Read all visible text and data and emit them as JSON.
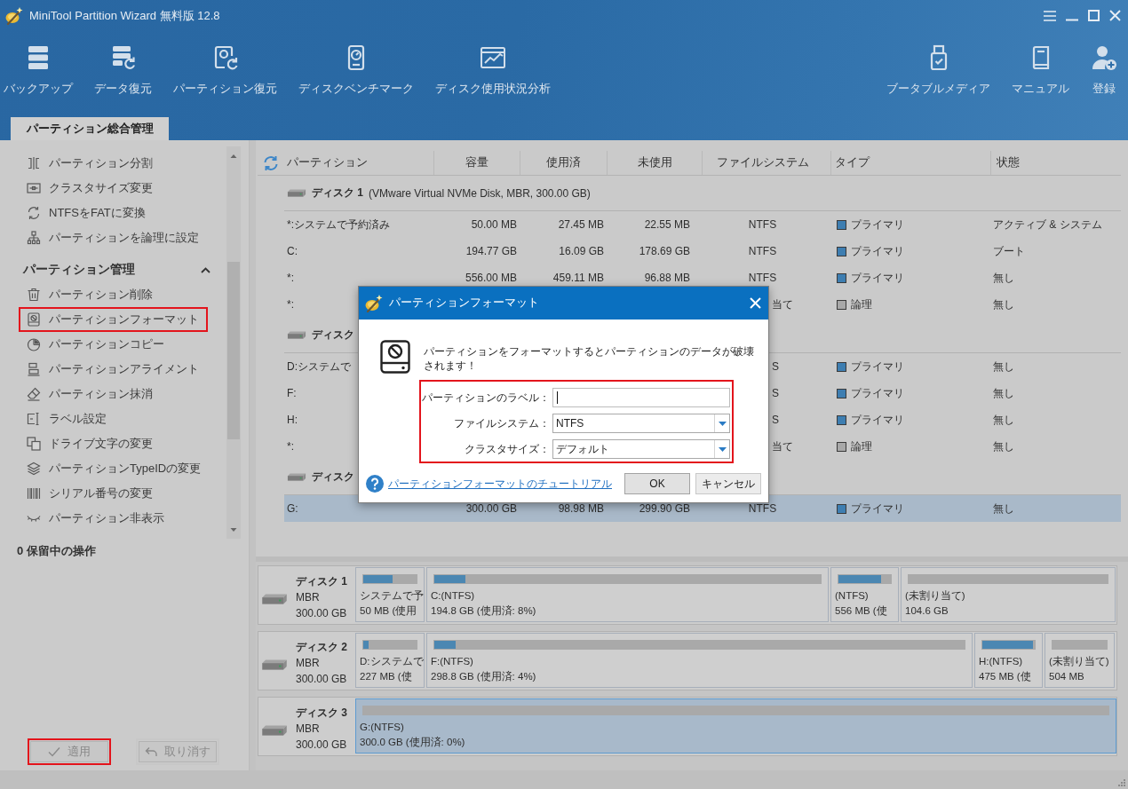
{
  "window": {
    "title": "MiniTool Partition Wizard 無料版 12.8"
  },
  "toolbar": {
    "left": [
      "バックアップ",
      "データ復元",
      "パーティション復元",
      "ディスクベンチマーク",
      "ディスク使用状況分析"
    ],
    "right": [
      "ブータブルメディア",
      "マニュアル",
      "登録"
    ]
  },
  "tabs": [
    {
      "label": "パーティション総合管理",
      "selected": true
    }
  ],
  "sidebar": {
    "groups": [
      {
        "items": [
          {
            "label": "パーティション分割",
            "highlighted": false
          },
          {
            "label": "クラスタサイズ変更",
            "highlighted": false
          },
          {
            "label": "NTFSをFATに変換",
            "highlighted": false
          },
          {
            "label": "パーティションを論理に設定",
            "highlighted": false
          }
        ]
      },
      {
        "title": "パーティション管理",
        "expanded": true,
        "items": [
          {
            "label": "パーティション削除",
            "highlighted": false
          },
          {
            "label": "パーティションフォーマット",
            "highlighted": true
          },
          {
            "label": "パーティションコピー",
            "highlighted": false
          },
          {
            "label": "パーティションアライメント",
            "highlighted": false
          },
          {
            "label": "パーティション抹消",
            "highlighted": false
          },
          {
            "label": "ラベル設定",
            "highlighted": false
          },
          {
            "label": "ドライブ文字の変更",
            "highlighted": false
          },
          {
            "label": "パーティションTypeIDの変更",
            "highlighted": false
          },
          {
            "label": "シリアル番号の変更",
            "highlighted": false
          },
          {
            "label": "パーティション非表示",
            "highlighted": false
          }
        ]
      }
    ],
    "pending": "0 保留中の操作",
    "buttons": [
      {
        "label": "適用",
        "disabled": true,
        "highlighted": true
      },
      {
        "label": "取り消す",
        "disabled": true,
        "highlighted": false
      }
    ]
  },
  "table": {
    "columns": [
      "パーティション",
      "容量",
      "使用済",
      "未使用",
      "ファイルシステム",
      "タイプ",
      "状態"
    ],
    "disks": [
      {
        "name": "ディスク 1",
        "details": "(VMware Virtual NVMe Disk, MBR, 300.00 GB)",
        "rows": [
          {
            "kind": "full",
            "partition": "*:システムで予約済み",
            "capacity": "50.00 MB",
            "used": "27.45 MB",
            "unused": "22.55 MB",
            "file_system": "NTFS",
            "type": {
              "label": "プライマリ",
              "color": "#3e7eb1"
            },
            "status": "アクティブ & システム",
            "selected": false
          },
          {
            "kind": "full",
            "partition": "C:",
            "capacity": "194.77 GB",
            "used": "16.09 GB",
            "unused": "178.69 GB",
            "file_system": "NTFS",
            "type": {
              "label": "プライマリ",
              "color": "#3e7eb1"
            },
            "status": "ブート",
            "selected": false
          },
          {
            "kind": "full",
            "partition": "*:",
            "capacity": "556.00 MB",
            "used": "459.11 MB",
            "unused": "96.88 MB",
            "file_system": "NTFS",
            "type": {
              "label": "プライマリ",
              "color": "#3e7eb1"
            },
            "status": "無し",
            "selected": false
          },
          {
            "kind": "covered",
            "partition": "*:",
            "file_system": "当て",
            "type": {
              "label": "論理",
              "color": "#a8a8a8"
            },
            "status": "無し",
            "selected": false
          }
        ]
      },
      {
        "name": "ディスク",
        "rows": [
          {
            "kind": "covered",
            "partition": "D:システムで",
            "file_system": "S",
            "type": {
              "label": "プライマリ",
              "color": "#3e7eb1"
            },
            "status": "無し",
            "selected": false
          },
          {
            "kind": "covered",
            "partition": "F:",
            "file_system": "S",
            "type": {
              "label": "プライマリ",
              "color": "#3e7eb1"
            },
            "status": "無し",
            "selected": false
          },
          {
            "kind": "covered",
            "partition": "H:",
            "file_system": "S",
            "type": {
              "label": "プライマリ",
              "color": "#3e7eb1"
            },
            "status": "無し",
            "selected": false
          },
          {
            "kind": "covered",
            "partition": "*:",
            "file_system": "当て",
            "type": {
              "label": "論理",
              "color": "#a8a8a8"
            },
            "status": "無し",
            "selected": false
          }
        ]
      },
      {
        "name": "ディスク",
        "rows": [
          {
            "kind": "full",
            "partition": "G:",
            "capacity": "300.00 GB",
            "used": "98.98 MB",
            "unused": "299.90 GB",
            "file_system": "NTFS",
            "type": {
              "label": "プライマリ",
              "color": "#3e7eb1"
            },
            "status": "無し",
            "selected": true
          }
        ]
      }
    ]
  },
  "disk_map": [
    {
      "name": "ディスク 1",
      "scheme": "MBR",
      "size": "300.00 GB",
      "partitions": [
        {
          "name": "システムで予",
          "size": "50 MB (使用",
          "level": 0.55,
          "selected": false
        },
        {
          "name": "C:(NTFS)",
          "size": "194.8 GB (使用済: 8%)",
          "level": 0.08,
          "selected": false
        },
        {
          "name": "(NTFS)",
          "size": "556 MB (使",
          "level": 0.82,
          "selected": false
        },
        {
          "name": "(未割り当て)",
          "size": "104.6 GB",
          "selected": false
        }
      ]
    },
    {
      "name": "ディスク 2",
      "scheme": "MBR",
      "size": "300.00 GB",
      "partitions": [
        {
          "name": "D:システムで",
          "size": "227 MB (使",
          "level": 0.1,
          "selected": false
        },
        {
          "name": "F:(NTFS)",
          "size": "298.8 GB (使用済: 4%)",
          "level": 0.04,
          "selected": false
        },
        {
          "name": "H:(NTFS)",
          "size": "475 MB (使",
          "level": 0.97,
          "selected": false
        },
        {
          "name": "(未割り当て)",
          "size": "504 MB",
          "selected": false
        }
      ]
    },
    {
      "name": "ディスク 3",
      "scheme": "MBR",
      "size": "300.00 GB",
      "partitions": [
        {
          "name": "G:(NTFS)",
          "size": "300.0 GB (使用済: 0%)",
          "selected": true
        }
      ]
    }
  ],
  "dialog": {
    "title": "パーティションフォーマット",
    "warning": "パーティションをフォーマットするとパーティションのデータが破壊されます！",
    "fields_highlighted": true,
    "fields": [
      {
        "kind": "text",
        "label": "パーティションのラベル：",
        "focused": true
      },
      {
        "kind": "select",
        "label": "ファイルシステム：",
        "value": "NTFS"
      },
      {
        "kind": "select",
        "label": "クラスタサイズ：",
        "value": "デフォルト"
      }
    ],
    "help_link": "パーティションフォーマットのチュートリアル",
    "buttons": [
      {
        "label": "OK",
        "default": true
      },
      {
        "label": "キャンセル",
        "default": false
      }
    ]
  }
}
